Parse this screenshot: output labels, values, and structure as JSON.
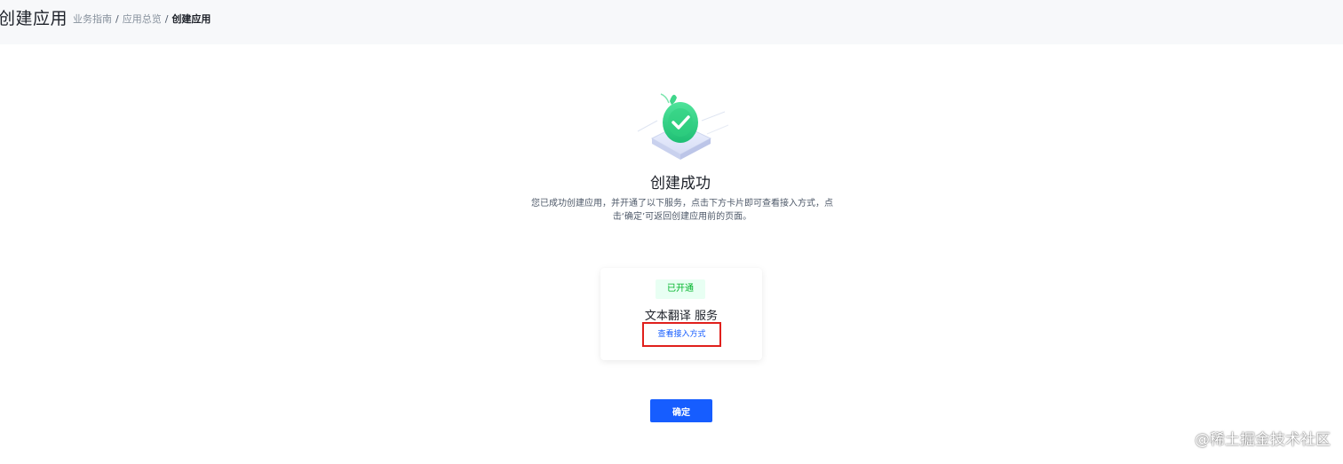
{
  "header": {
    "title": "创建应用",
    "breadcrumb": {
      "items": [
        "业务指南",
        "应用总览"
      ],
      "current": "创建应用",
      "separator": "/"
    }
  },
  "result": {
    "icon": "success-check-icon",
    "title": "创建成功",
    "description_line1": "您已成功创建应用，并开通了以下服务，点击下方卡片即可查看接入方式，点",
    "description_line2": "击‘确定’可返回创建应用前的页面。"
  },
  "service_card": {
    "status": "已开通",
    "name": "文本翻译 服务",
    "link_label": "查看接入方式"
  },
  "confirm_label": "确定",
  "watermark": "@稀土掘金技术社区",
  "colors": {
    "primary": "#165dff",
    "success": "#00b42a",
    "success_bg": "#e8fff3",
    "highlight_border": "#e0201c",
    "header_bg": "#f7f8fa"
  }
}
